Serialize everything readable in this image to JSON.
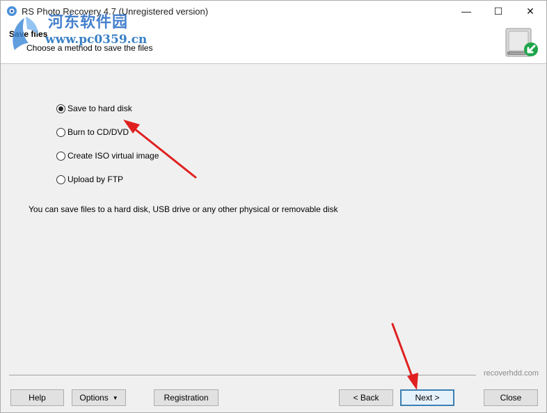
{
  "window": {
    "title": "RS Photo Recovery 4.7 (Unregistered version)",
    "controls": {
      "minimize": "—",
      "maximize": "☐",
      "close": "✕"
    }
  },
  "watermark": {
    "text_cn": "河东软件园",
    "url": "www.pc0359.cn"
  },
  "wizard": {
    "title": "Save files",
    "subtitle": "Choose a method to save the files"
  },
  "options": [
    {
      "label": "Save to hard disk",
      "checked": true
    },
    {
      "label": "Burn to CD/DVD",
      "checked": false
    },
    {
      "label": "Create ISO virtual image",
      "checked": false
    },
    {
      "label": "Upload by FTP",
      "checked": false
    }
  ],
  "description": "You can save files to a hard disk, USB drive or any other physical or removable disk",
  "brand": "recoverhdd.com",
  "buttons": {
    "help": "Help",
    "options": "Options",
    "registration": "Registration",
    "back": "< Back",
    "next": "Next >",
    "close": "Close"
  },
  "icons": {
    "app": "app-icon",
    "drive": "hard-drive-icon",
    "options_caret": "caret-down-icon"
  },
  "colors": {
    "annotation_arrow": "#e02020",
    "default_button_border": "#3c7fb1"
  }
}
